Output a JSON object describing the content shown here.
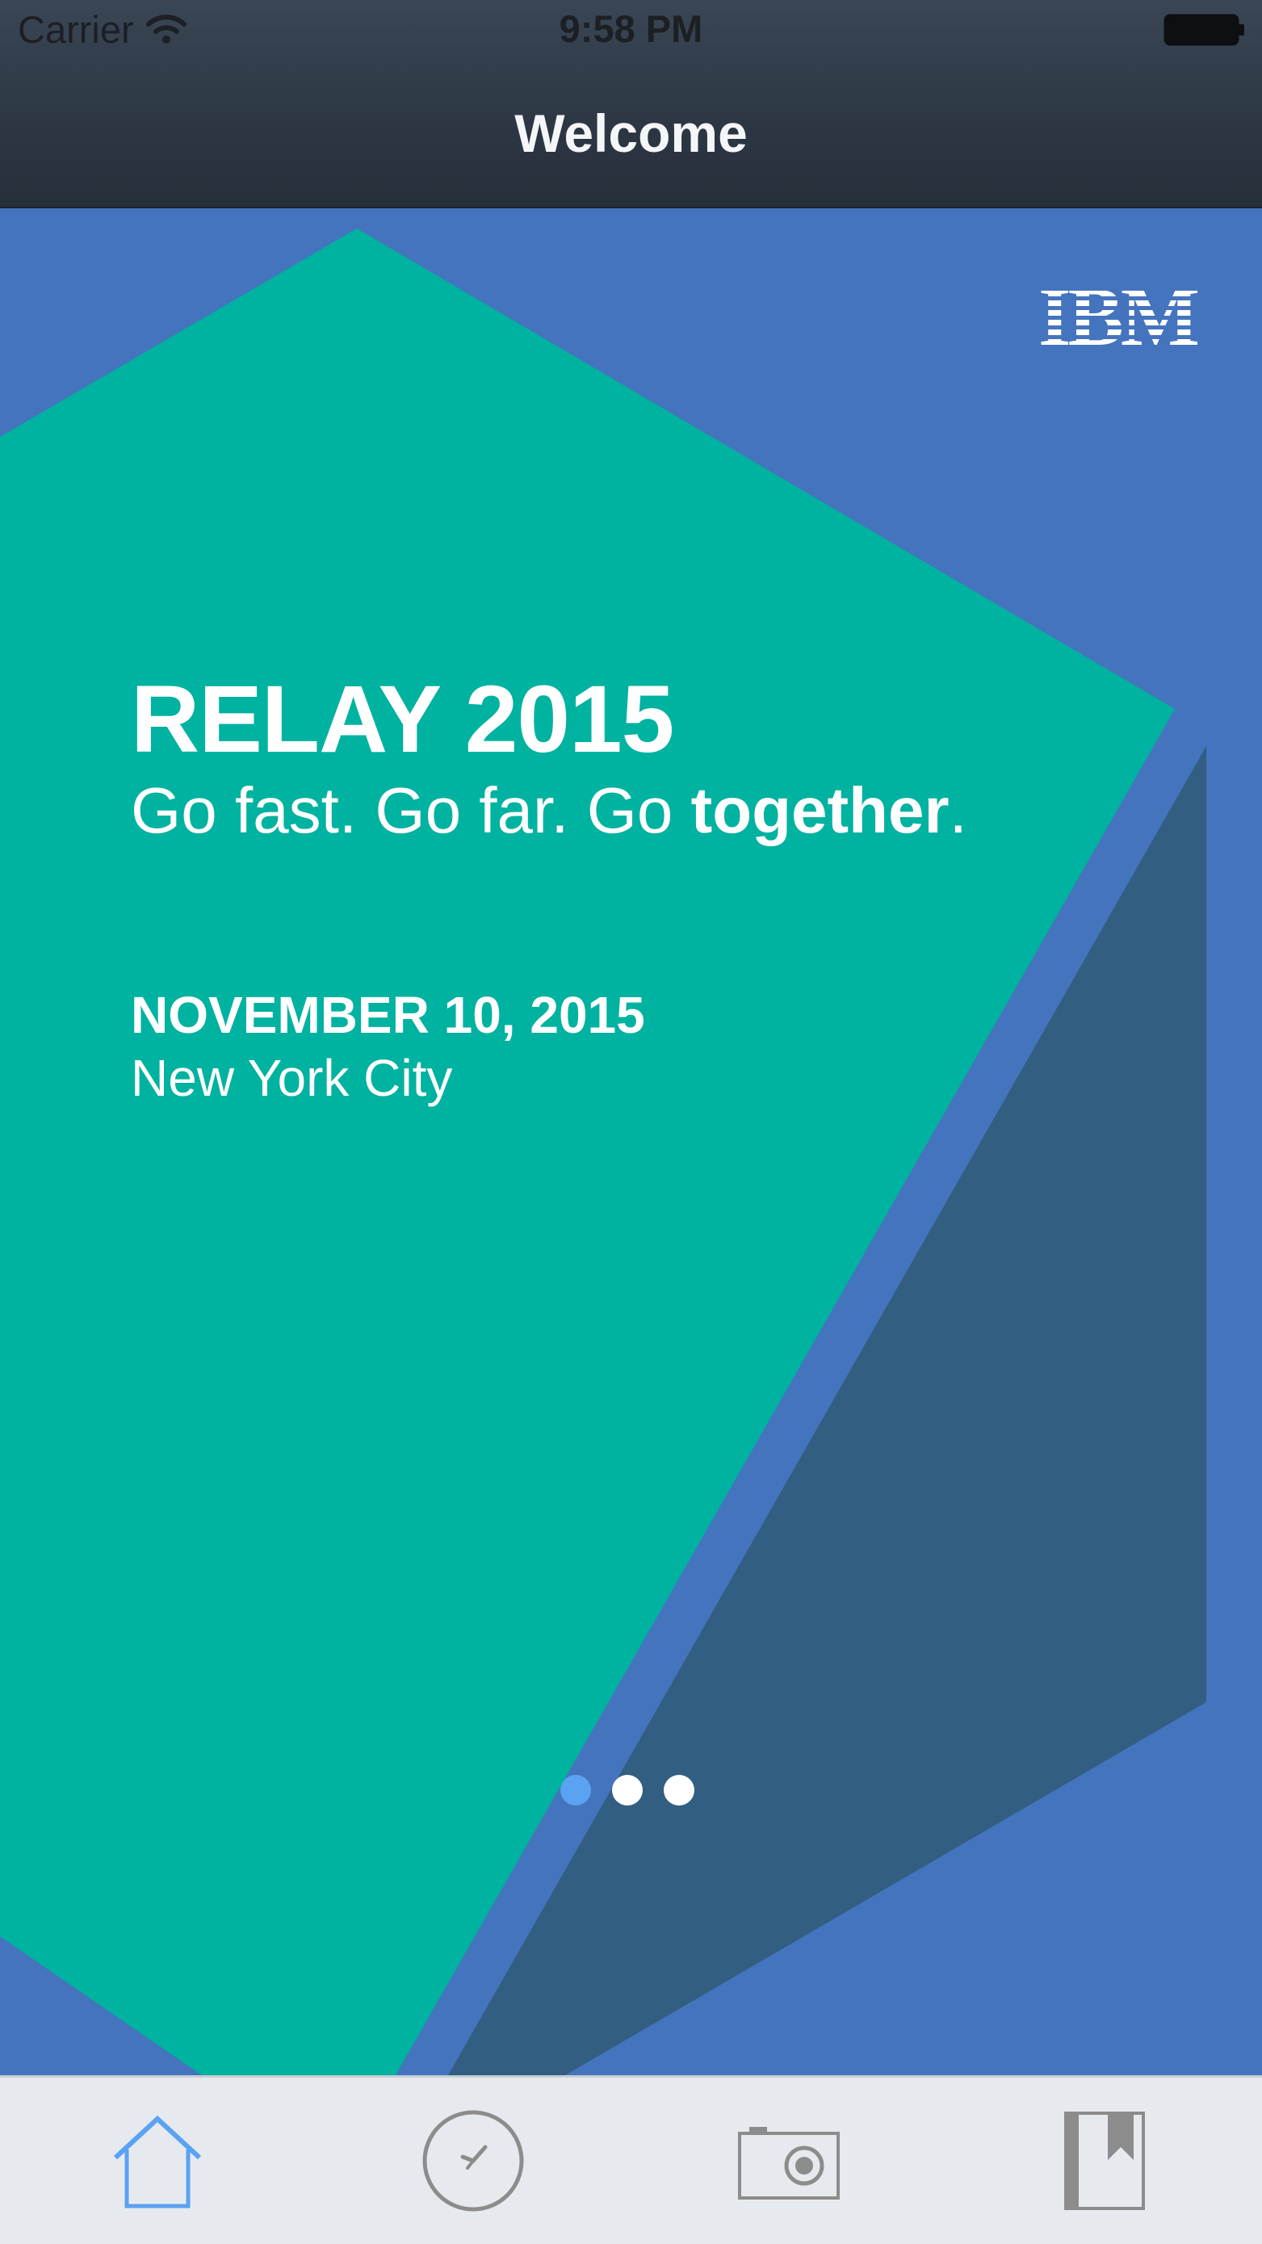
{
  "status_bar": {
    "carrier": "Carrier",
    "time": "9:58 PM"
  },
  "nav": {
    "title": "Welcome"
  },
  "hero": {
    "logo_text": "IBM",
    "title": "RELAY 2015",
    "tagline_regular": "Go fast. Go far. Go ",
    "tagline_bold": "together",
    "tagline_end": ".",
    "date": "NOVEMBER 10, 2015",
    "city": "New York City",
    "page_count": 3,
    "current_page": 1
  },
  "tabs": [
    {
      "icon": "home-icon",
      "active": true
    },
    {
      "icon": "clock-icon",
      "active": false
    },
    {
      "icon": "camera-icon",
      "active": false
    },
    {
      "icon": "bookmark-icon",
      "active": false
    }
  ],
  "colors": {
    "background_blue": "#4474bd",
    "teal": "#00b2a0",
    "navy": "#325e82",
    "active_tab": "#5aa2f2",
    "inactive_tab": "#8c8c8c"
  }
}
